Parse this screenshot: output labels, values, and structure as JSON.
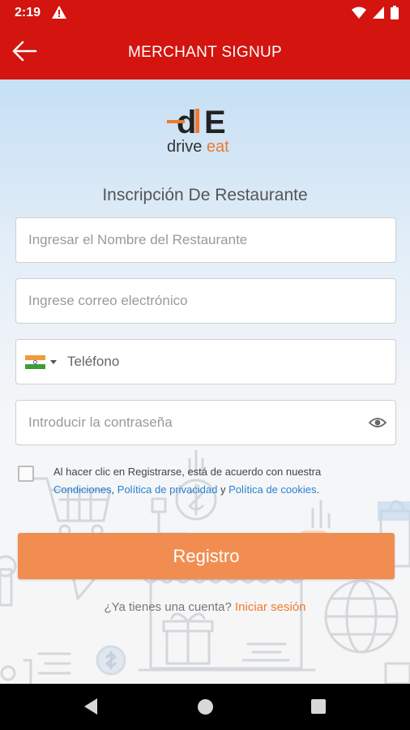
{
  "status_bar": {
    "time": "2:19",
    "icons": [
      "alert-icon",
      "wifi-icon",
      "signal-icon",
      "battery-icon"
    ]
  },
  "app_bar": {
    "title": "MERCHANT SIGNUP",
    "back_icon": "arrow-left-icon"
  },
  "logo": {
    "mark": "dE",
    "word_drive": "drive",
    "word_eat": "eat",
    "brand_color": "#f07a2f"
  },
  "form": {
    "title": "Inscripción De Restaurante",
    "restaurant_name_placeholder": "Ingresar el Nombre del  Restaurante",
    "email_placeholder": "Ingrese correo electrónico",
    "phone_placeholder": "Teléfono",
    "phone_country_flag": "india-flag-icon",
    "password_placeholder": "Introducir la contraseña",
    "password_toggle_icon": "eye-icon"
  },
  "terms": {
    "checked": false,
    "prefix": "Al hacer clic en Registrarse, está de acuerdo con nuestra",
    "link_conditions": "Condiciones",
    "sep1": ", ",
    "link_privacy": "Política de privacidad",
    "sep2": " y ",
    "link_cookies": "Política de cookies",
    "suffix": "."
  },
  "register_button": "Registro",
  "signin": {
    "question": "¿Ya tienes una cuenta?",
    "link": "Iniciar sesión"
  },
  "colors": {
    "header_red": "#d3140f",
    "button_orange": "#f28d52",
    "link_blue": "#2a7fd4"
  },
  "nav_bar": {
    "icons": [
      "nav-back-icon",
      "nav-home-icon",
      "nav-recents-icon"
    ]
  }
}
